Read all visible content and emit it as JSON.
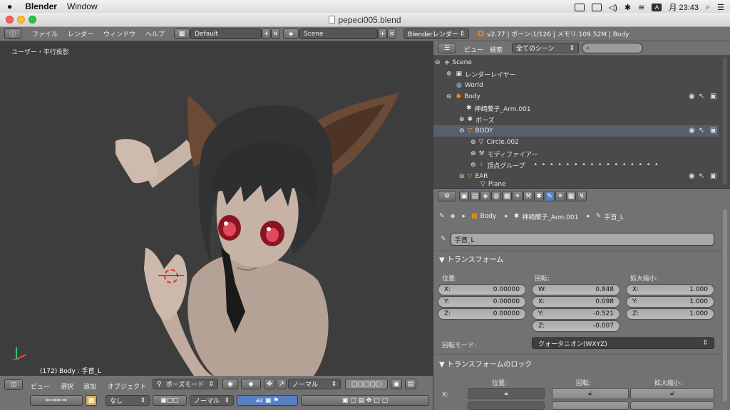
{
  "mac": {
    "app_name": "Blender",
    "menu": [
      "Window"
    ],
    "clock": "月 23:43",
    "input_indicator": "A"
  },
  "window": {
    "title": "pepeci005.blend"
  },
  "header": {
    "menus": [
      "ファイル",
      "レンダー",
      "ウィンドウ",
      "ヘルプ"
    ],
    "layout": "Default",
    "scene": "Scene",
    "engine": "Blenderレンダー",
    "stats": "v2.77 | ボーン:1/126 | メモリ:109.52M | Body"
  },
  "viewport": {
    "view_label": "ユーザー・平行投影",
    "object_label": "(172) Body : 手首_L"
  },
  "viewport_header": {
    "menus": [
      "ビュー",
      "選択",
      "追加",
      "オブジェクト"
    ],
    "mode": "ポーズモード",
    "orientation": "ノーマル",
    "none_label": "なし",
    "normal2": "ノーマル"
  },
  "outliner": {
    "menus": [
      "ビュー",
      "検索"
    ],
    "scene_filter": "全てのシーン",
    "items": [
      {
        "label": "Scene",
        "indent": 0
      },
      {
        "label": "レンダーレイヤー",
        "indent": 1
      },
      {
        "label": "World",
        "indent": 1
      },
      {
        "label": "Body",
        "indent": 1
      },
      {
        "label": "神崎蘭子_Arm.001",
        "indent": 2
      },
      {
        "label": "ポーズ",
        "indent": 2
      },
      {
        "label": "BODY",
        "indent": 2
      },
      {
        "label": "Circle.002",
        "indent": 3
      },
      {
        "label": "モディファイアー",
        "indent": 3
      },
      {
        "label": "頂点グループ",
        "indent": 3
      },
      {
        "label": "EAR",
        "indent": 2
      },
      {
        "label": "Plane",
        "indent": 3
      }
    ]
  },
  "properties": {
    "breadcrumb": [
      "Body",
      "神崎蘭子_Arm.001",
      "手首_L"
    ],
    "bone_name": "手首_L",
    "transform": {
      "title": "トランスフォーム",
      "location_label": "位置:",
      "rotation_label": "回転:",
      "scale_label": "拡大縮小:",
      "location": [
        {
          "axis": "X:",
          "value": "0.00000"
        },
        {
          "axis": "Y:",
          "value": "0.00000"
        },
        {
          "axis": "Z:",
          "value": "0.00000"
        }
      ],
      "rotation": [
        {
          "axis": "W:",
          "value": "0.848"
        },
        {
          "axis": "X:",
          "value": "0.098"
        },
        {
          "axis": "Y:",
          "value": "-0.521"
        },
        {
          "axis": "Z:",
          "value": "-0.007"
        }
      ],
      "scale": [
        {
          "axis": "X:",
          "value": "1.000"
        },
        {
          "axis": "Y:",
          "value": "1.000"
        },
        {
          "axis": "Z:",
          "value": "1.000"
        }
      ],
      "rotation_mode_label": "回転モード:",
      "rotation_mode": "クォータニオン(WXYZ)"
    },
    "lock": {
      "title": "トランスフォームのロック",
      "location_label": "位置:",
      "rotation_label": "回転:",
      "scale_label": "拡大縮小:",
      "x_label": "X:"
    }
  },
  "colors": {
    "accent": "#5680c2",
    "viewport_bg": "#3d3d3d",
    "header_bg": "#727272"
  }
}
